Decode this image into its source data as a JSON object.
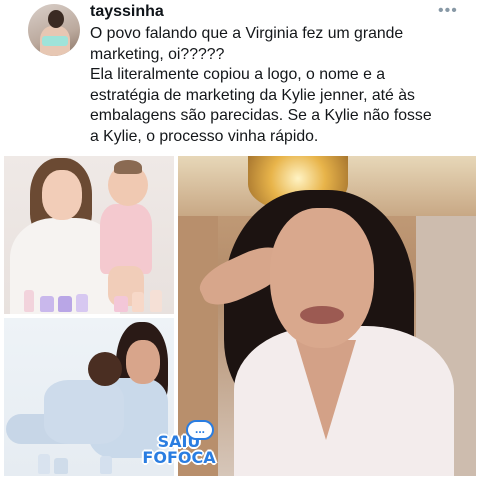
{
  "tweet": {
    "username": "tayssinha",
    "more_icon": "more-horizontal-icon",
    "text_lines": [
      "O povo falando que a Virginia fez um grande",
      "marketing, oi?????",
      "Ela literalmente copiou a logo, o nome e a",
      "estratégia de marketing da Kylie jenner, até às",
      "embalagens são parecidas. Se a Kylie não fosse",
      "a Kylie, o processo vinha rápido."
    ]
  },
  "media": {
    "watermark": {
      "line1": "SAIU",
      "line2": "FOFOCA",
      "bubble": "..."
    }
  },
  "colors": {
    "text": "#0f1419",
    "watermark": "#2a7de1",
    "muted": "#8899a6"
  }
}
